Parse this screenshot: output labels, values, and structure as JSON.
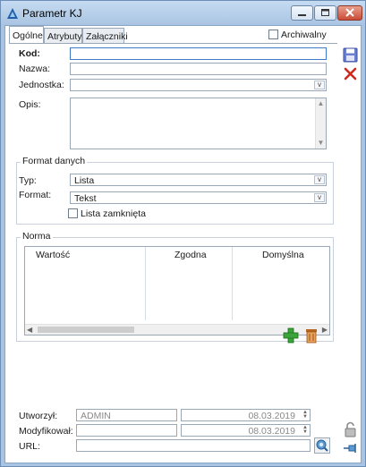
{
  "window": {
    "title": "Parametr KJ"
  },
  "tabs": [
    {
      "label": "Ogólne"
    },
    {
      "label": "Atrybuty"
    },
    {
      "label": "Załączniki"
    }
  ],
  "archiwalny": {
    "label": "Archiwalny",
    "checked": false
  },
  "form": {
    "kod": {
      "label": "Kod:",
      "value": ""
    },
    "nazwa": {
      "label": "Nazwa:",
      "value": ""
    },
    "jednostka": {
      "label": "Jednostka:",
      "value": ""
    },
    "opis": {
      "label": "Opis:",
      "value": ""
    }
  },
  "format_danych": {
    "title": "Format danych",
    "typ_label": "Typ:",
    "typ_value": "Lista",
    "format_label": "Format:",
    "format_value": "Tekst",
    "lista_zamknieta_label": "Lista zamknięta",
    "lista_zamknieta_checked": false
  },
  "norma": {
    "title": "Norma",
    "columns": [
      "Wartość",
      "Zgodna",
      "Domyślna"
    ],
    "rows": []
  },
  "footer": {
    "utworzyl_label": "Utworzył:",
    "utworzyl_user": "ADMIN",
    "utworzyl_date": "08.03.2019",
    "modyfikowal_label": "Modyfikował:",
    "modyfikowal_user": "",
    "modyfikowal_date": "08.03.2019",
    "url_label": "URL:",
    "url_value": ""
  },
  "icons": {
    "save": "floppy-disk-icon",
    "cancel": "red-x-icon",
    "add": "green-plus-icon",
    "delete": "trash-icon",
    "lock": "padlock-icon",
    "pin": "pushpin-icon",
    "url_open": "globe-search-icon"
  },
  "colors": {
    "accent": "#3d7ac7",
    "add_green": "#3aa33a",
    "cancel_red": "#d0281c"
  }
}
